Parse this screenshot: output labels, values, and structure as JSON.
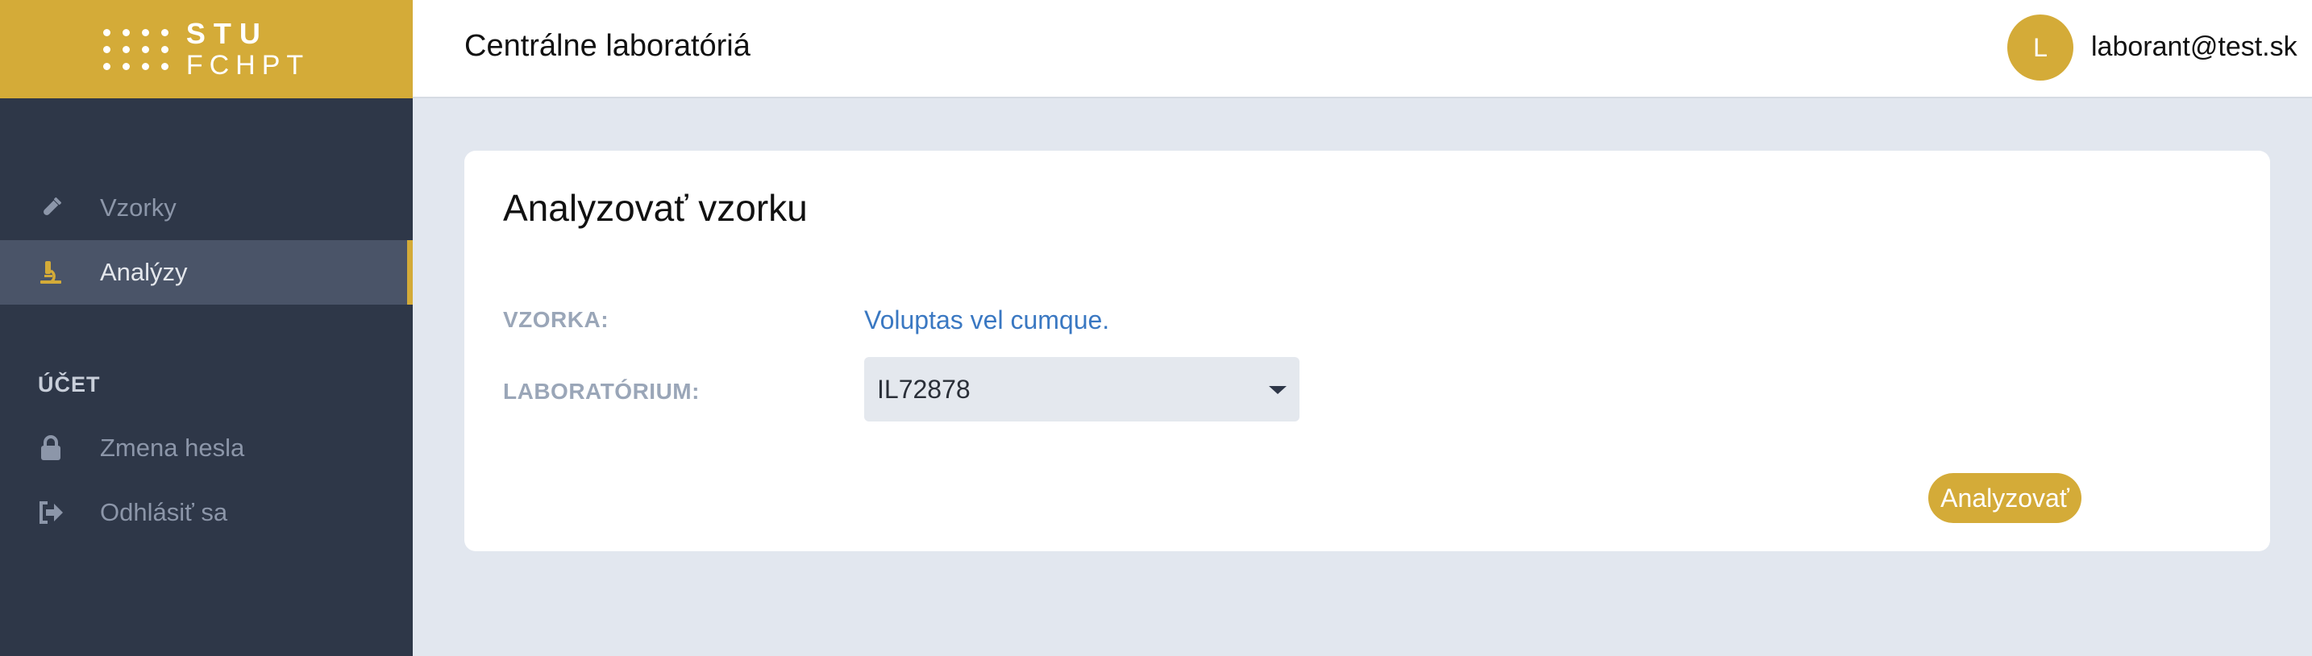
{
  "brand": {
    "line1": "STU",
    "line2": "FCHPT",
    "color": "#d4ab38"
  },
  "sidebar": {
    "items": [
      {
        "label": "Vzorky",
        "icon": "test-tube-icon",
        "active": false
      },
      {
        "label": "Analýzy",
        "icon": "microscope-icon",
        "active": true
      }
    ],
    "account_section": "ÚČET",
    "account_items": [
      {
        "label": "Zmena hesla",
        "icon": "lock-icon"
      },
      {
        "label": "Odhlásiť sa",
        "icon": "sign-out-icon"
      }
    ]
  },
  "header": {
    "title": "Centrálne laboratóriá",
    "avatar_initial": "L",
    "user_email": "laborant@test.sk"
  },
  "card": {
    "title": "Analyzovať vzorku",
    "sample_label": "VZORKA:",
    "sample_value": "Voluptas vel cumque.",
    "lab_label": "LABORATÓRIUM:",
    "lab_value": "IL72878",
    "submit_label": "Analyzovať"
  },
  "colors": {
    "accent": "#d4ab38",
    "sidebar": "#2e3748",
    "link": "#3a78c2",
    "background": "#e2e7ef"
  }
}
